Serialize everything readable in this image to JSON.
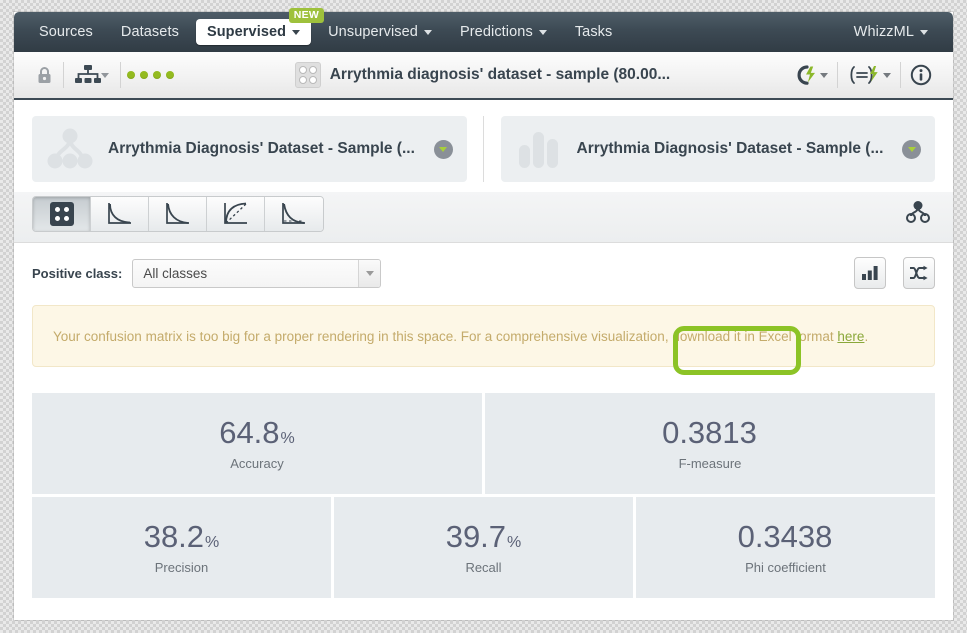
{
  "nav": {
    "items": [
      {
        "label": "Sources",
        "has_caret": false,
        "active": false,
        "badge": ""
      },
      {
        "label": "Datasets",
        "has_caret": false,
        "active": false,
        "badge": ""
      },
      {
        "label": "Supervised",
        "has_caret": true,
        "active": true,
        "badge": "NEW"
      },
      {
        "label": "Unsupervised",
        "has_caret": true,
        "active": false,
        "badge": ""
      },
      {
        "label": "Predictions",
        "has_caret": true,
        "active": false,
        "badge": ""
      },
      {
        "label": "Tasks",
        "has_caret": false,
        "active": false,
        "badge": ""
      }
    ],
    "account": {
      "label": "WhizzML",
      "has_caret": true
    }
  },
  "header": {
    "lock_icon": "lock-icon",
    "model_icon": "sitemap-icon",
    "status_dots": 4,
    "status_color": "#94bb20",
    "resource_icon": "confusion-matrix-icon",
    "title": "Arrythmia diagnosis' dataset - sample (80.00...",
    "right_icons": [
      {
        "name": "cloud-flash-icon",
        "has_caret": true
      },
      {
        "name": "script-flash-icon",
        "has_caret": true
      },
      {
        "name": "info-icon",
        "has_caret": false
      }
    ]
  },
  "cards": [
    {
      "icon": "decision-tree-icon",
      "title": "Arrythmia Diagnosis' Dataset - Sample (..."
    },
    {
      "icon": "bar-chart-icon",
      "title": "Arrythmia Diagnosis' Dataset - Sample (..."
    }
  ],
  "tabs": [
    {
      "name": "tab-confusion-matrix",
      "icon": "confusion-matrix-icon",
      "active": true
    },
    {
      "name": "tab-roc-curve",
      "icon": "roc-curve-icon",
      "active": false
    },
    {
      "name": "tab-precision-recall-curve",
      "icon": "precision-recall-curve-icon",
      "active": false
    },
    {
      "name": "tab-gain-curve",
      "icon": "gain-curve-icon",
      "active": false
    },
    {
      "name": "tab-lift-curve",
      "icon": "lift-curve-icon",
      "active": false
    }
  ],
  "tabs_right_icon": "model-node-icon",
  "positive_class": {
    "label": "Positive class:",
    "selected": "All classes",
    "placeholder": "All classes",
    "options": [
      "All classes"
    ]
  },
  "toolbar_right": [
    {
      "name": "bar-chart-toggle-button",
      "icon": "bar-chart-icon"
    },
    {
      "name": "shuffle-button",
      "icon": "shuffle-icon"
    }
  ],
  "banner": {
    "text_before": "Your confusion matrix is too big for a proper rendering in this space. For a comprehensive visualization, download it in Excel format ",
    "link_text": "here",
    "text_after": ".",
    "background": "#fdf7e6",
    "text_color": "#c4ab6b",
    "link_color": "#8aa83a"
  },
  "annotation": {
    "color": "#8cc326",
    "target": "banner-link"
  },
  "metrics": {
    "rows": [
      [
        {
          "value": "64.8",
          "unit": "%",
          "label": "Accuracy"
        },
        {
          "value": "0.3813",
          "unit": "",
          "label": "F-measure"
        }
      ],
      [
        {
          "value": "38.2",
          "unit": "%",
          "label": "Precision"
        },
        {
          "value": "39.7",
          "unit": "%",
          "label": "Recall"
        },
        {
          "value": "0.3438",
          "unit": "",
          "label": "Phi coefficient"
        }
      ]
    ]
  }
}
